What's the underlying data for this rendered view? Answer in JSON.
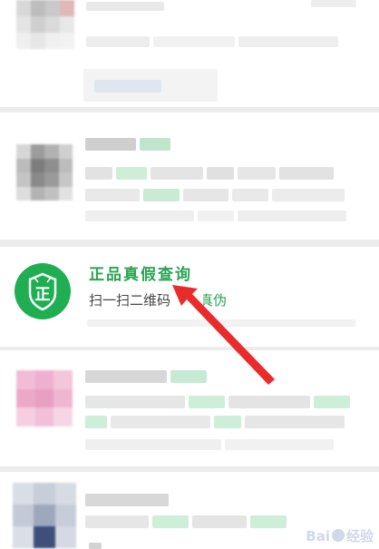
{
  "target_item": {
    "title": "正品真假查询",
    "desc_part_a": "扫一扫二维码",
    "desc_part_b": "产品真伪",
    "logo_glyph": "正",
    "logo_icon": "shield-zheng-icon",
    "accent_color": "#2aa352"
  },
  "watermark": {
    "text": "Bai",
    "text_suffix": "经验",
    "icon": "baidu-paw-icon"
  },
  "annotation": {
    "icon": "red-arrow-icon",
    "color": "#ea2b2b"
  }
}
